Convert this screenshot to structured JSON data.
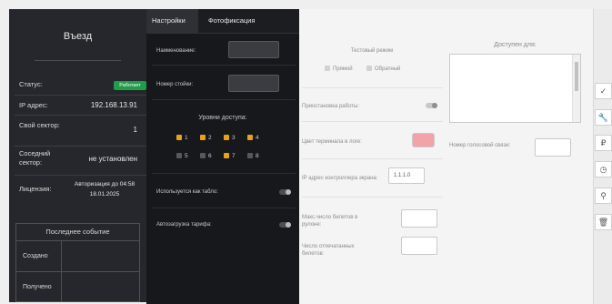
{
  "entry": {
    "title": "Въезд",
    "status_label": "Статус:",
    "status_value": "Работает",
    "ip_label": "IP адрес:",
    "ip_value": "192.168.13.91",
    "own_sector_label": "Свой сектор:",
    "own_sector_value": "1",
    "neighbor_sector_label": "Соседний сектор:",
    "neighbor_sector_value": "не установлен",
    "license_label": "Лицензия:",
    "license_value": "Авторизация до 04:58 18.01.2025",
    "last_event_title": "Последнее событие",
    "created_label": "Создано",
    "received_label": "Получено"
  },
  "tabs": [
    {
      "label": "Настройки",
      "active": true
    },
    {
      "label": "Фотофиксация",
      "active": false
    }
  ],
  "settings": {
    "name_label": "Наименование:",
    "name_value": "",
    "rack_number_label": "Номер стойки:",
    "rack_number_value": "",
    "access_levels_title": "Уровни доступа:",
    "access_levels": [
      {
        "label": "1",
        "checked": true
      },
      {
        "label": "2",
        "checked": true
      },
      {
        "label": "3",
        "checked": true
      },
      {
        "label": "4",
        "checked": true
      },
      {
        "label": "5",
        "checked": false
      },
      {
        "label": "6",
        "checked": false
      },
      {
        "label": "7",
        "checked": true
      },
      {
        "label": "8",
        "checked": false
      }
    ],
    "used_as_board_label": "Используется как табло:",
    "autoload_tariff_label": "Автозагрузка тарифа:"
  },
  "terminal": {
    "test_mode_title": "Тестовый режим",
    "direct_label": "Прямой",
    "reverse_label": "Обратный",
    "pause_work_label": "Приостановка работы:",
    "logo_color_label": "Цвет терминала в логе:",
    "logo_color": "#f2a3aa",
    "display_controller_ip_label": "IP адрес контроллера экрана:",
    "display_controller_ip_value": "1.1.1.0",
    "max_tickets_label": "Макс.число билетов в рулоне:",
    "max_tickets_value": "",
    "printed_tickets_label": "Число отпечатанных билетов:",
    "printed_tickets_value": "",
    "available_for_label": "Доступен для:",
    "voice_number_label": "Номер голосовой связи:",
    "voice_number_value": ""
  },
  "toolbar": [
    {
      "icon": "check-icon",
      "glyph": "✓"
    },
    {
      "icon": "wrench-icon",
      "glyph": "🔧"
    },
    {
      "icon": "ruble-icon",
      "glyph": "₽"
    },
    {
      "icon": "clock-icon",
      "glyph": "◷"
    },
    {
      "icon": "award-icon",
      "glyph": "⚲"
    },
    {
      "icon": "trash-icon",
      "glyph": "🗑"
    }
  ],
  "colors": {
    "status_ok": "#1f9d4a",
    "level_checked": "#e8a21a",
    "dark_bg": "#25272c",
    "mid_bg": "#17181b"
  }
}
